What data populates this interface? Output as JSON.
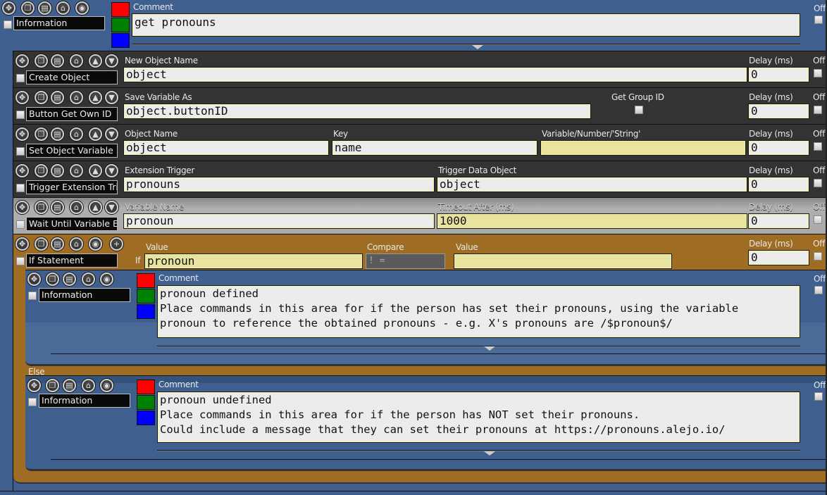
{
  "colors": {
    "blue_panel": "#3f5f8e",
    "dark_row": "#333333",
    "wait_row": "#a9a9a9",
    "if_row": "#9e6c22",
    "swatch_red": "#ff0000",
    "swatch_green": "#008000",
    "swatch_blue": "#0000ff"
  },
  "common": {
    "off_label": "Off",
    "delay_label": "Delay (ms)",
    "comment_label": "Comment"
  },
  "top_info": {
    "name": "Information",
    "comment": "get pronouns"
  },
  "create_object": {
    "name": "Create Object",
    "field_label": "New Object Name",
    "value": "object",
    "delay": "0"
  },
  "button_get_own_id": {
    "name": "Button Get Own ID",
    "field_label": "Save Variable As",
    "value": "object.buttonID",
    "group_label": "Get Group ID",
    "delay": "0"
  },
  "set_object_variable": {
    "name": "Set Object Variable",
    "object_label": "Object Name",
    "object_value": "object",
    "key_label": "Key",
    "key_value": "name",
    "var_label": "Variable/Number/'String'",
    "var_value": "",
    "delay": "0"
  },
  "trigger_extension": {
    "name": "Trigger Extension Trig",
    "trigger_label": "Extension Trigger",
    "trigger_value": "pronouns",
    "data_label": "Trigger Data Object",
    "data_value": "object",
    "delay": "0"
  },
  "wait_until": {
    "name": "Wait Until Variable Ex",
    "var_label": "Variable Name",
    "var_value": "pronoun",
    "timeout_label": "Timeout After (ms)",
    "timeout_value": "1000",
    "delay": "0"
  },
  "if_statement": {
    "name": "If Statement",
    "if_label": "If",
    "value_label": "Value",
    "value": "pronoun",
    "compare_label": "Compare",
    "compare_value": "! =",
    "value2_label": "Value",
    "value2": "",
    "delay": "0"
  },
  "if_info": {
    "name": "Information",
    "comment": "pronoun defined\nPlace commands in this area for if the person has set their pronouns, using the variable\npronoun to reference the obtained pronouns - e.g. X's pronouns are /$pronoun$/"
  },
  "else_label": "Else",
  "else_info": {
    "name": "Information",
    "comment": "pronoun undefined\nPlace commands in this area for if the person has NOT set their pronouns.\nCould include a message that they can set their pronouns at https://pronouns.alejo.io/"
  },
  "icons": {
    "move": "✥",
    "copy": "❐",
    "paste": "▤",
    "delete": "🗑",
    "eye": "◉",
    "up": "▲",
    "down": "▼",
    "add": "+"
  }
}
